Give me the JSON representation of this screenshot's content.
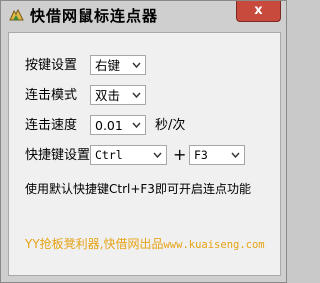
{
  "window": {
    "title": "快借网鼠标连点器",
    "close_label": "x",
    "close_color": "#c74a3d"
  },
  "icons": {
    "app_icon": "mouse-app-icon",
    "dropdown_arrow": "chevron-down-icon"
  },
  "form": {
    "button_setting": {
      "label": "按键设置",
      "value": "右键"
    },
    "click_mode": {
      "label": "连击模式",
      "value": "双击"
    },
    "click_speed": {
      "label": "连击速度",
      "value": "0.01",
      "unit": "秒/次"
    },
    "hotkey": {
      "label": "快捷键设置",
      "modifier": "Ctrl",
      "plus": "+",
      "key": "F3"
    }
  },
  "hint_text": "使用默认快捷键Ctrl+F3即可开启连点功能",
  "footer": {
    "text": "YY抢板凳利器,快借网出品",
    "url": "www.kuaiseng.com",
    "color": "#e6a316"
  }
}
